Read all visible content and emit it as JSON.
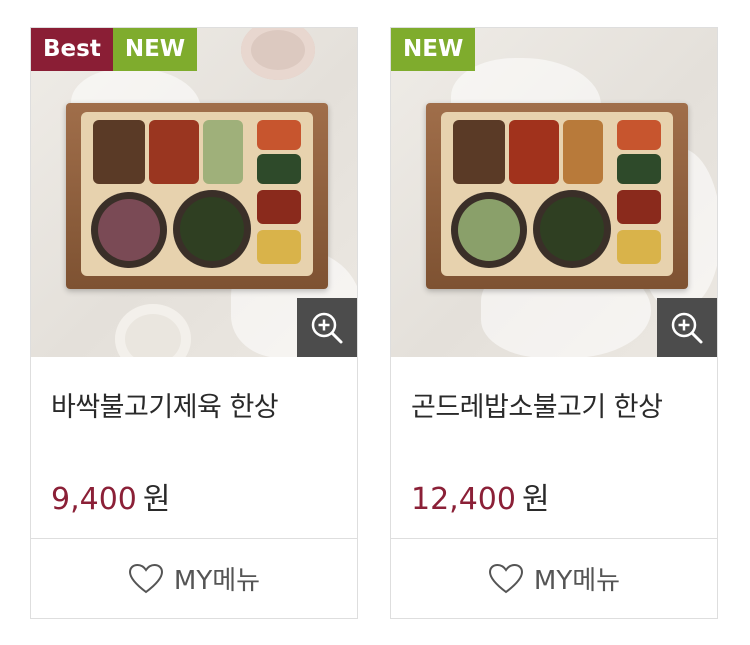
{
  "products": [
    {
      "name": "바싹불고기제육 한상",
      "price": "9,400",
      "currency": "원",
      "badges": [
        "Best",
        "NEW"
      ],
      "my_menu_label": "MY메뉴"
    },
    {
      "name": "곤드레밥소불고기 한상",
      "price": "12,400",
      "currency": "원",
      "badges": [
        "NEW"
      ],
      "my_menu_label": "MY메뉴"
    }
  ],
  "colors": {
    "best_badge": "#8a1e35",
    "new_badge": "#7fac2d",
    "price": "#8b2037",
    "zoom_bg": "#4c4c4c"
  },
  "icons": [
    "zoom-in-icon",
    "heart-icon"
  ]
}
